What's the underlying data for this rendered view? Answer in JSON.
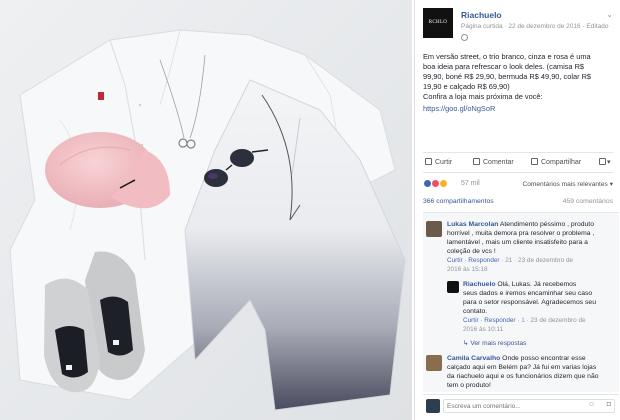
{
  "page": {
    "avatar_text": "RCHLO",
    "name": "Riachuelo",
    "meta": "Página curtida · 22 de dezembro de 2016 · Editado",
    "options_glyph": "⌄"
  },
  "post": {
    "text_lines": [
      "Em versão street, o trio branco, cinza e rosa é uma",
      "boa ideia para refrescar o look deles. (camisa R$",
      "99,90, boné R$ 29,90, bermuda R$ 49,90, colar R$",
      "19,90 e calçado R$ 69,90)",
      "Confira a loja mais próxima de você:"
    ],
    "link": "https://goo.gl/oNgSoR"
  },
  "actions": {
    "like": "Curtir",
    "comment": "Comentar",
    "share": "Compartilhar"
  },
  "reactions": {
    "count": "57 mil",
    "order": "Comentários mais relevantes ▾",
    "colors": [
      "#4267b2",
      "#ed5167",
      "#f7b125"
    ]
  },
  "shares": {
    "count": "366 compartilhamentos",
    "comments": "459 comentários"
  },
  "comments": [
    {
      "author": "Lukas Marcolan",
      "text_lines": [
        "Atendimento péssimo , produto",
        "horrível , muita demora pra resolver o problema ,",
        "lamentável , mais um cliente insatisfeito para a",
        "coleção de vcs !"
      ],
      "meta_actions": "Curtir · Responder",
      "meta_rest": " · 21 · 23 de dezembro de",
      "meta_rest2": "2016 às 15:18"
    },
    {
      "author": "Riachuelo",
      "text_lines": [
        "Olá, Lukas. Já recebemos",
        "seus dados e iremos encaminhar seu caso",
        "para o setor responsável. Agradecemos seu",
        "contato."
      ],
      "meta_actions": "Curtir · Responder",
      "meta_rest": " · 1 · 23 de dezembro de",
      "meta_rest2": "2016 às 10:11"
    },
    {
      "author": "Camila Carvalho",
      "text_lines": [
        "Onde posso encontrar esse",
        "calçado aqui em Belém pa? Já fui em varias lojas",
        "da riachuelo aqui e os funcionários dizem que não",
        "tem o produto!"
      ]
    }
  ],
  "more_replies": "Ver mais respostas",
  "composer": {
    "placeholder": "Escreva um comentário...",
    "emoji": "☺",
    "camera": "◘"
  },
  "colors": {
    "link": "#365899",
    "muted": "#90949c",
    "panel_bg": "#ffffff",
    "comments_bg": "#f6f7f9"
  }
}
